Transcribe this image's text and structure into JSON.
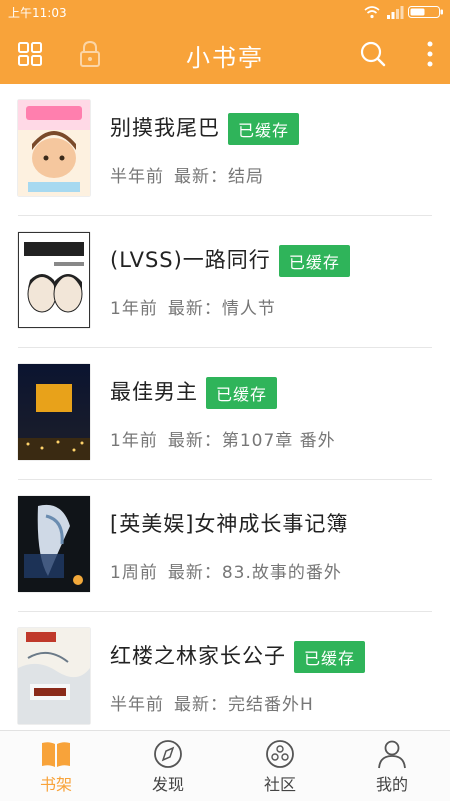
{
  "status_bar": {
    "time": "上午11:03"
  },
  "app_bar": {
    "title": "小书亭"
  },
  "books": [
    {
      "title": "别摸我尾巴",
      "cached": true,
      "badge": "已缓存",
      "time": "半年前",
      "latest": "最新：结局"
    },
    {
      "title": "(LVSS)一路同行",
      "cached": true,
      "badge": "已缓存",
      "time": "1年前",
      "latest": "最新：情人节"
    },
    {
      "title": "最佳男主",
      "cached": true,
      "badge": "已缓存",
      "time": "1年前",
      "latest": "最新：第107章 番外"
    },
    {
      "title": "[英美娱]女神成长事记簿",
      "cached": false,
      "badge": "",
      "time": "1周前",
      "latest": "最新：83.故事的番外"
    },
    {
      "title": "红楼之林家长公子",
      "cached": true,
      "badge": "已缓存",
      "time": "半年前",
      "latest": "最新：完结番外H"
    }
  ],
  "bottom_nav": [
    {
      "label": "书架",
      "icon": "book-icon",
      "active": true
    },
    {
      "label": "发现",
      "icon": "compass-icon",
      "active": false
    },
    {
      "label": "社区",
      "icon": "community-icon",
      "active": false
    },
    {
      "label": "我的",
      "icon": "user-icon",
      "active": false
    }
  ],
  "colors": {
    "accent": "#f8a33a",
    "badge": "#2fb45a"
  }
}
